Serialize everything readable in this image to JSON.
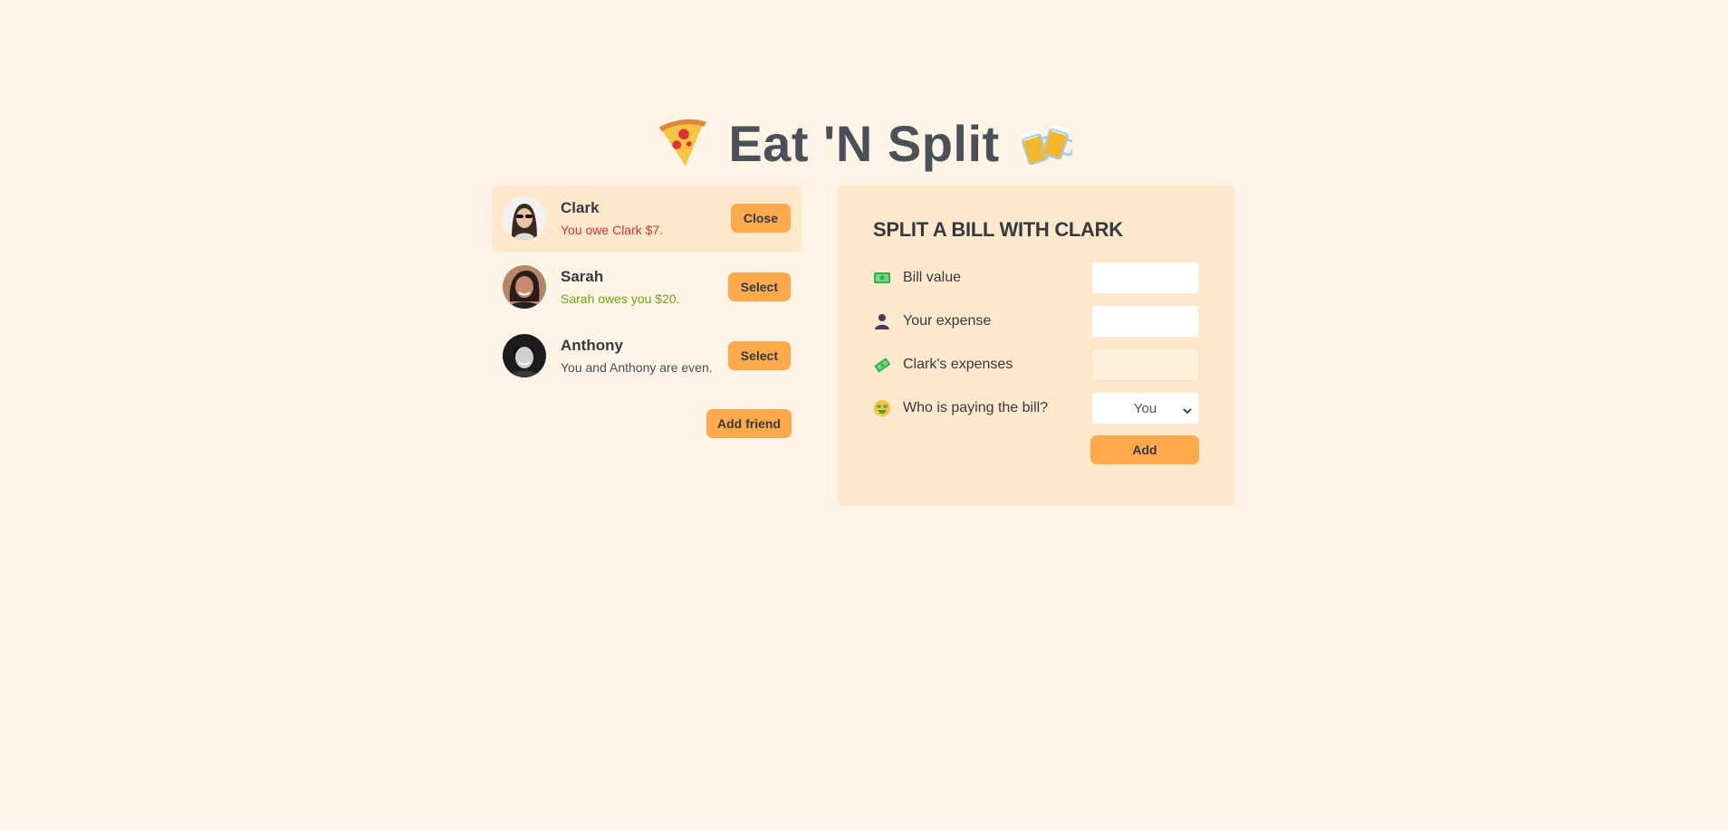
{
  "app": {
    "title": "Eat 'N Split"
  },
  "friends": [
    {
      "name": "Clark",
      "balance_text": "You owe Clark $7.",
      "tone": "red",
      "button": "Close",
      "selected": true
    },
    {
      "name": "Sarah",
      "balance_text": "Sarah owes you $20.",
      "tone": "green",
      "button": "Select",
      "selected": false
    },
    {
      "name": "Anthony",
      "balance_text": "You and Anthony are even.",
      "tone": "neutral",
      "button": "Select",
      "selected": false
    }
  ],
  "add_friend_label": "Add friend",
  "split_form": {
    "title": "Split a bill with Clark",
    "bill_value_label": "Bill value",
    "bill_value": "",
    "your_expense_label": "Your expense",
    "your_expense": "",
    "friend_expense_label": "Clark's expenses",
    "friend_expense": "",
    "payer_label": "Who is paying the bill?",
    "payer_selected": "You",
    "submit_label": "Add"
  },
  "colors": {
    "background": "#fff4e6",
    "panel": "#ffe8cc",
    "accent": "#ffa94d",
    "owe_red": "#e03131",
    "owed_green": "#66a80f",
    "text": "#495057"
  },
  "icons": {
    "logo_left": "pizza-icon",
    "logo_right": "beer-mugs-icon",
    "bill": "money-bill-icon",
    "expense": "person-icon",
    "friend_expense": "money-wings-icon",
    "payer": "money-face-icon"
  }
}
